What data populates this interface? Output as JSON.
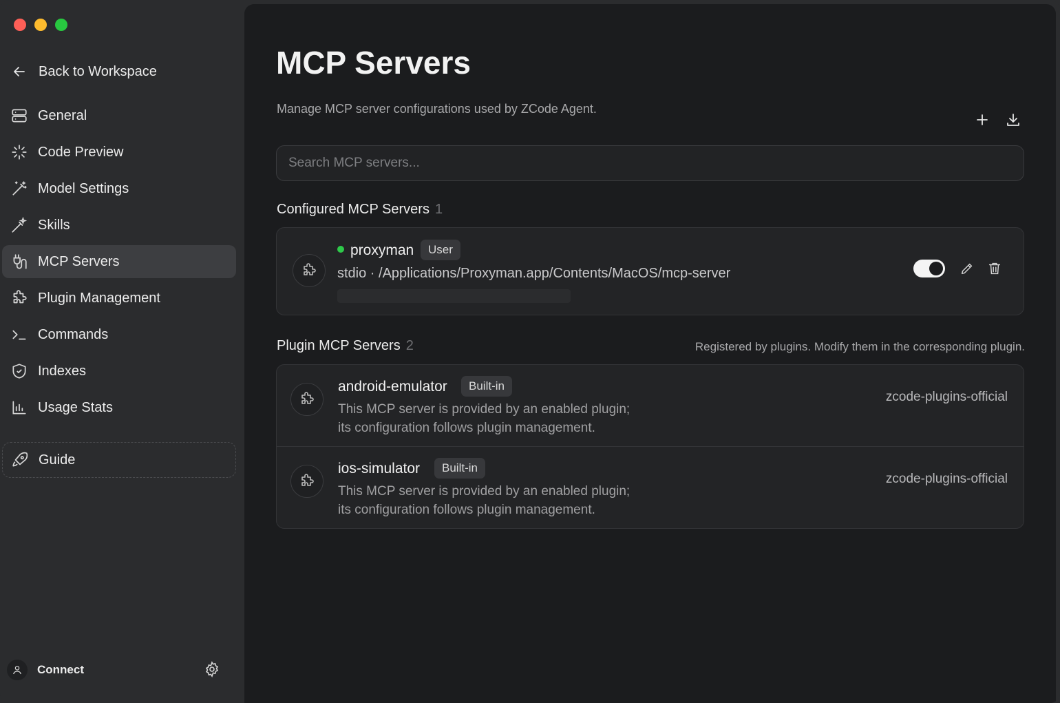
{
  "sidebar": {
    "back_label": "Back to Workspace",
    "items": [
      {
        "label": "General",
        "icon": "server-icon",
        "active": false
      },
      {
        "label": "Code Preview",
        "icon": "sparkle-icon",
        "active": false
      },
      {
        "label": "Model Settings",
        "icon": "wand-icon",
        "active": false
      },
      {
        "label": "Skills",
        "icon": "magic-wand-icon",
        "active": false
      },
      {
        "label": "MCP Servers",
        "icon": "plug-icon",
        "active": true
      },
      {
        "label": "Plugin Management",
        "icon": "puzzle-icon",
        "active": false
      },
      {
        "label": "Commands",
        "icon": "terminal-icon",
        "active": false
      },
      {
        "label": "Indexes",
        "icon": "shield-icon",
        "active": false
      },
      {
        "label": "Usage Stats",
        "icon": "bar-chart-icon",
        "active": false
      }
    ],
    "guide_label": "Guide",
    "footer": {
      "connect_label": "Connect"
    }
  },
  "main": {
    "title": "MCP Servers",
    "subtitle": "Manage MCP server configurations used by ZCode Agent.",
    "search_placeholder": "Search MCP servers...",
    "configured": {
      "heading": "Configured MCP Servers",
      "count": "1",
      "servers": [
        {
          "name": "proxyman",
          "badge": "User",
          "status_color": "#2ec94a",
          "command": "stdio · /Applications/Proxyman.app/Contents/MacOS/mcp-server",
          "enabled": true
        }
      ]
    },
    "plugin": {
      "heading": "Plugin MCP Servers",
      "count": "2",
      "note": "Registered by plugins. Modify them in the corresponding plugin.",
      "servers": [
        {
          "name": "android-emulator",
          "badge": "Built-in",
          "desc_line1": "This MCP server is provided by an enabled plugin;",
          "desc_line2": "its configuration follows plugin management.",
          "source": "zcode-plugins-official"
        },
        {
          "name": "ios-simulator",
          "badge": "Built-in",
          "desc_line1": "This MCP server is provided by an enabled plugin;",
          "desc_line2": "its configuration follows plugin management.",
          "source": "zcode-plugins-official"
        }
      ]
    }
  },
  "colors": {
    "sidebar_bg": "#2b2c2e",
    "main_bg": "#1b1c1e",
    "active_item_bg": "#3d3e41",
    "status_green": "#2ec94a"
  }
}
